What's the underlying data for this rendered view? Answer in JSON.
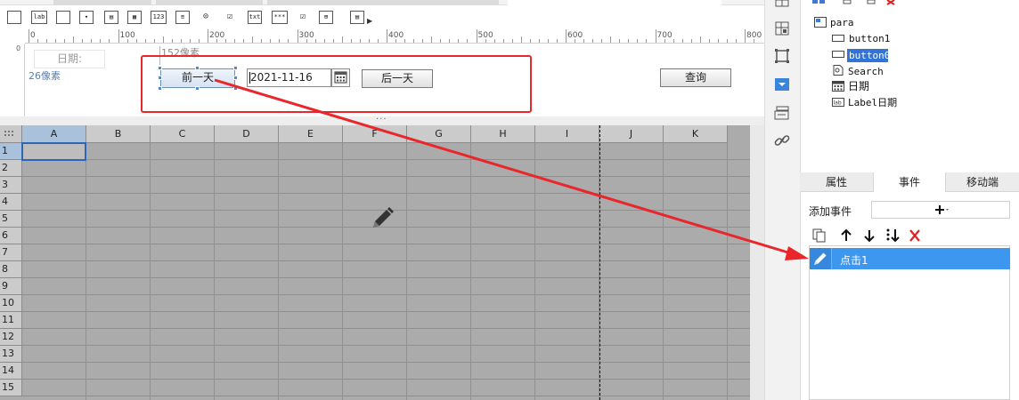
{
  "designer": {
    "ruler": {
      "marks": [
        "0",
        "100",
        "200",
        "300",
        "400",
        "500",
        "600",
        "700",
        "800"
      ],
      "left_mark": "0"
    },
    "param_panel": {
      "date_label": "日期:",
      "px_top_hint": "152像素",
      "px_left_hint": "26像素",
      "prev_day_button": "前一天",
      "date_value": "2021-11-16",
      "next_day_button": "后一天",
      "query_button": "查询"
    },
    "splitter_glyph": "···",
    "grid": {
      "columns": [
        "A",
        "B",
        "C",
        "D",
        "E",
        "F",
        "G",
        "H",
        "I",
        "J",
        "K"
      ],
      "rows": [
        "1",
        "2",
        "3",
        "4",
        "5",
        "6",
        "7",
        "8",
        "9",
        "10",
        "11",
        "12",
        "13",
        "14",
        "15"
      ],
      "selected_cell": "A1"
    }
  },
  "widget_tree": {
    "nodes": [
      {
        "label": "para",
        "icon": "panel-icon"
      },
      {
        "label": "button1",
        "icon": "button-widget-icon"
      },
      {
        "label": "button0",
        "icon": "button-widget-icon",
        "selected": true
      },
      {
        "label": "Search",
        "icon": "search-doc-icon"
      },
      {
        "label": "日期",
        "icon": "date-widget-icon"
      },
      {
        "label": "Label日期",
        "icon": "label-widget-icon"
      }
    ]
  },
  "panel": {
    "tabs": [
      "属性",
      "事件",
      "移动端"
    ],
    "active_tab": "事件",
    "add_event_label": "添加事件",
    "add_event_glyph": "+",
    "events": [
      {
        "label": "点击1",
        "icon": "pencil-icon"
      }
    ]
  },
  "colors": {
    "highlight_red": "#e9262b",
    "selection_blue": "#3e97ee",
    "grid_gray": "#ababab"
  }
}
